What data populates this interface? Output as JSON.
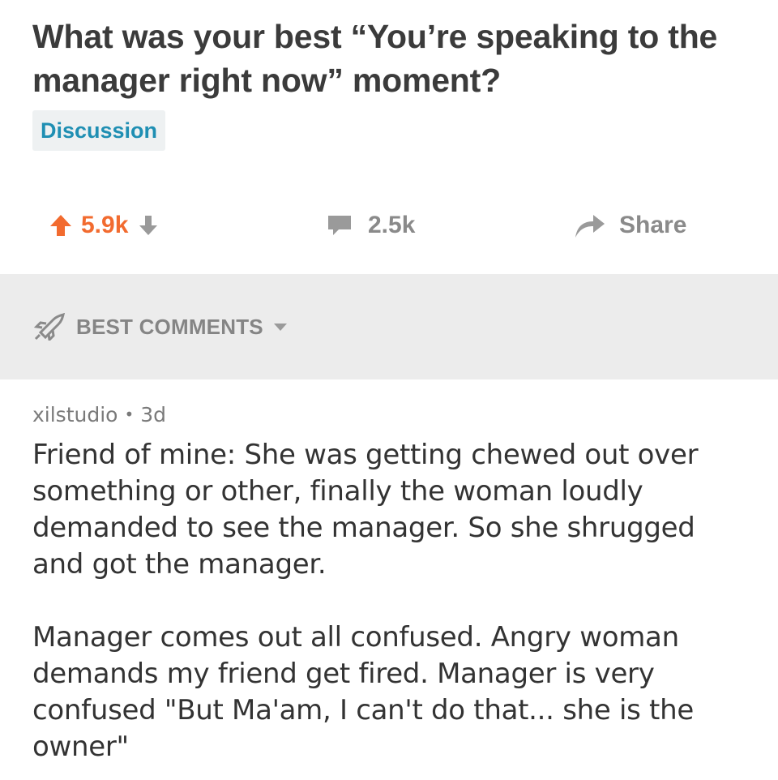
{
  "post": {
    "title": "What was your best “You’re speaking to the manager right now” moment?",
    "flair": "Discussion"
  },
  "actions": {
    "score": "5.9k",
    "comment_count": "2.5k",
    "share_label": "Share",
    "upvote_icon": "arrow-up-icon",
    "downvote_icon": "arrow-down-icon",
    "comment_icon": "speech-bubble-icon",
    "share_icon": "share-arrow-icon"
  },
  "sort": {
    "label": "BEST COMMENTS",
    "icon": "rocket-icon"
  },
  "comment": {
    "author": "xilstudio",
    "separator": "•",
    "age": "3d",
    "paragraphs": [
      "Friend of mine:  She was getting chewed out over something or other, finally the woman loudly demanded to see the manager.  So she shrugged and got the manager.",
      "Manager comes out all confused.  Angry woman demands my friend get fired.  Manager is very confused  \"But Ma'am, I can't do that... she is the owner\""
    ]
  },
  "colors": {
    "upvote": "#f26b2f",
    "flair_text": "#1f8fb3",
    "muted": "#8a8a8a",
    "sort_bar_bg": "#ececec"
  }
}
